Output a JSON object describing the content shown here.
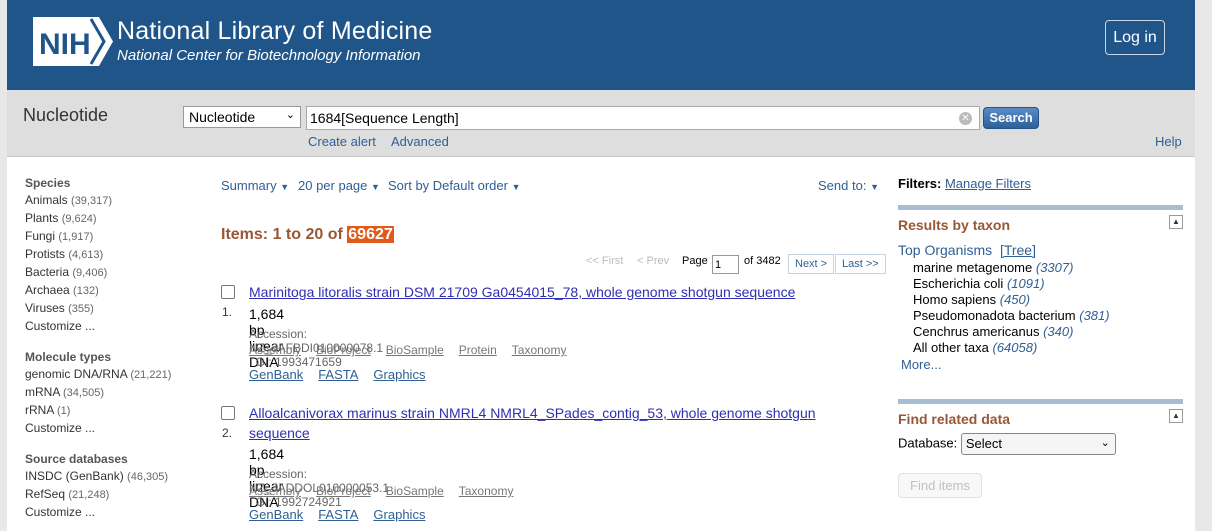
{
  "header": {
    "logo_text": "NIH",
    "title": "National Library of Medicine",
    "subtitle": "National Center for Biotechnology Information",
    "login_label": "Log in",
    "bg_color": "#20558a"
  },
  "search": {
    "db_title": "Nucleotide",
    "db_selected": "Nucleotide",
    "query": "1684[Sequence Length]",
    "search_label": "Search",
    "create_alert": "Create alert",
    "advanced": "Advanced",
    "help": "Help"
  },
  "sidebar": {
    "species": {
      "heading": "Species",
      "items": [
        {
          "label": "Animals",
          "count": "(39,317)"
        },
        {
          "label": "Plants",
          "count": "(9,624)"
        },
        {
          "label": "Fungi",
          "count": "(1,917)"
        },
        {
          "label": "Protists",
          "count": "(4,613)"
        },
        {
          "label": "Bacteria",
          "count": "(9,406)"
        },
        {
          "label": "Archaea",
          "count": "(132)"
        },
        {
          "label": "Viruses",
          "count": "(355)"
        }
      ],
      "customize": "Customize ..."
    },
    "molecule": {
      "heading": "Molecule types",
      "items": [
        {
          "label": "genomic DNA/RNA",
          "count": "(21,221)"
        },
        {
          "label": "mRNA",
          "count": "(34,505)"
        },
        {
          "label": "rRNA",
          "count": "(1)"
        }
      ],
      "customize": "Customize ..."
    },
    "source": {
      "heading": "Source databases",
      "items": [
        {
          "label": "INSDC (GenBank)",
          "count": "(46,305)"
        },
        {
          "label": "RefSeq",
          "count": "(21,248)"
        }
      ],
      "customize": "Customize ..."
    }
  },
  "toolbar": {
    "summary": "Summary",
    "per_page": "20 per page",
    "sort": "Sort by Default order",
    "send_to": "Send to:"
  },
  "results_info": {
    "prefix": "Items: 1 to 20 of",
    "total": "69627"
  },
  "pager": {
    "first": "<< First",
    "prev": "< Prev",
    "page_label": "Page",
    "page_value": "1",
    "of_pages": "of 3482",
    "next": "Next >",
    "last": "Last >>"
  },
  "results": [
    {
      "num": "1.",
      "title": "Marinitoga litoralis strain DSM 21709 Ga0454015_78, whole genome shotgun sequence",
      "desc": "1,684 bp linear DNA",
      "accession": "Accession: NZ_JAFBDI010000078.1",
      "gi": "GI: 1993471659",
      "links": [
        "Assembly",
        "BioProject",
        "BioSample",
        "Protein",
        "Taxonomy"
      ],
      "links2": [
        "GenBank",
        "FASTA",
        "Graphics"
      ]
    },
    {
      "num": "2.",
      "title": "Alloalcanivorax marinus strain NMRL4 NMRL4_SPades_contig_53, whole genome shotgun sequence",
      "desc": "1,684 bp linear DNA",
      "accession": "Accession: NZ_JADDOL010000053.1",
      "gi": "GI: 1992724921",
      "links": [
        "Assembly",
        "BioProject",
        "BioSample",
        "Taxonomy"
      ],
      "links2": [
        "GenBank",
        "FASTA",
        "Graphics"
      ]
    }
  ],
  "right": {
    "filters_label": "Filters:",
    "manage_filters": "Manage Filters",
    "taxon": {
      "title": "Results by taxon",
      "top_org": "Top Organisms",
      "tree": "[Tree]",
      "items": [
        {
          "name": "marine metagenome",
          "count": "(3307)"
        },
        {
          "name": "Escherichia coli",
          "count": "(1091)"
        },
        {
          "name": "Homo sapiens",
          "count": "(450)"
        },
        {
          "name": "Pseudomonadota bacterium",
          "count": "(381)"
        },
        {
          "name": "Cenchrus americanus",
          "count": "(340)"
        },
        {
          "name": "All other taxa",
          "count": "(64058)"
        }
      ],
      "more": "More..."
    },
    "related": {
      "title": "Find related data",
      "db_label": "Database:",
      "db_selected": "Select",
      "find_items": "Find items"
    }
  }
}
